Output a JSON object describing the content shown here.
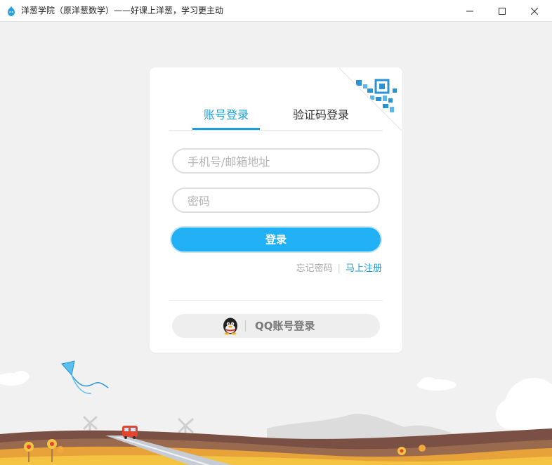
{
  "window": {
    "title": "洋葱学院（原洋葱数学）——好课上洋葱，学习更主动",
    "icon": "onion-app-icon",
    "controls": [
      "minimize-icon",
      "maximize-icon",
      "close-icon"
    ]
  },
  "login": {
    "tabs": [
      {
        "label": "账号登录",
        "active": true
      },
      {
        "label": "验证码登录",
        "active": false
      }
    ],
    "phone_placeholder": "手机号/邮箱地址",
    "password_placeholder": "密码",
    "login_button": "登录",
    "forgot_password": "忘记密码",
    "separator": "|",
    "register": "马上注册",
    "qq_login": "QQ账号登录",
    "qr_icon": "qr-code-icon"
  },
  "colors": {
    "accent": "#1b9fe3",
    "button": "#22b0f5",
    "background": "#f1f1f1"
  }
}
